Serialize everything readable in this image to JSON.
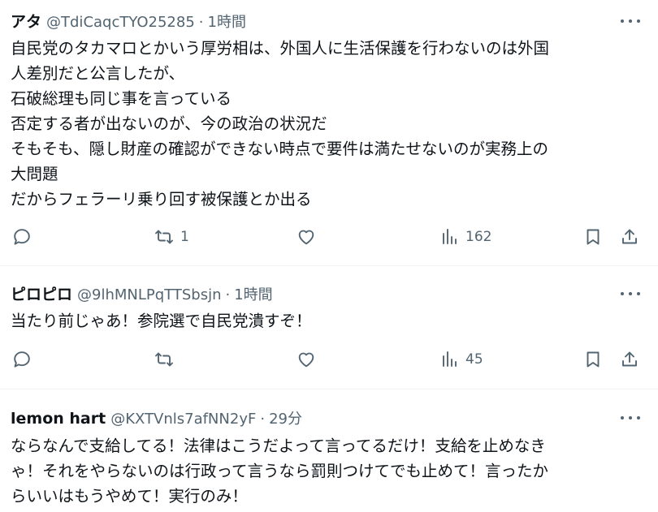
{
  "posts": [
    {
      "name": "アタ",
      "handle": "@TdiCaqcTYO25285",
      "separator": "·",
      "time": "1時間",
      "lines": [
        "自民党のタカマロとかいう厚労相は、外国人に生活保護を行わないのは外国",
        "人差別だと公言したが、",
        "石破総理も同じ事を言っている",
        "否定する者が出ないのが、今の政治の状況だ",
        "そもそも、隠し財産の確認ができない時点で要件は満たせないのが実務上の",
        "大問題",
        "だからフェラーリ乗り回す被保護とか出る"
      ],
      "retweets": "1",
      "views": "162"
    },
    {
      "name": "ピロピロ",
      "handle": "@9lhMNLPqTTSbsjn",
      "separator": "·",
      "time": "1時間",
      "lines": [
        "当たり前じゃあ！参院選で自民党潰すぞ！"
      ],
      "retweets": "",
      "views": "45"
    },
    {
      "name": "lemon hart",
      "handle": "@KXTVnls7afNN2yF",
      "separator": "·",
      "time": "29分",
      "lines": [
        "ならなんで支給してる！法律はこうだよって言ってるだけ！支給を止めなき",
        "ゃ！それをやらないのは行政って言うなら罰則つけてでも止めて！言ったか",
        "らいいはもうやめて！実行のみ！"
      ]
    }
  ],
  "icons": [
    "reply-icon",
    "retweet-icon",
    "like-icon",
    "views-icon",
    "bookmark-icon",
    "share-icon",
    "more-icon"
  ],
  "colors": {
    "text": "#0f1419",
    "secondary": "#536471",
    "divider": "#eff3f4"
  }
}
